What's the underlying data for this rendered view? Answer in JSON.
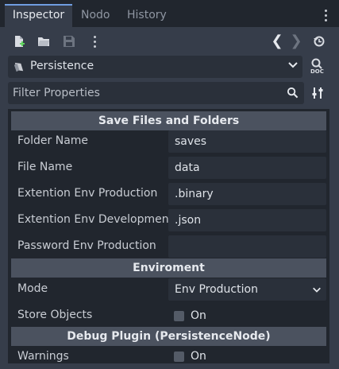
{
  "tabs": [
    {
      "label": "Inspector",
      "active": true
    },
    {
      "label": "Nodo",
      "active": false
    },
    {
      "label": "History",
      "active": false
    }
  ],
  "toolbar": {
    "back": "❮",
    "forward": "❯"
  },
  "resource": {
    "name": "Persistence",
    "doc_label": "DOC"
  },
  "filter": {
    "placeholder": "Filter Properties"
  },
  "sections": {
    "save": "Save Files and Folders",
    "env": "Enviroment",
    "debug": "Debug Plugin (PersistenceNode)"
  },
  "properties": {
    "folder_name": {
      "label": "Folder Name",
      "value": "saves"
    },
    "file_name": {
      "label": "File Name",
      "value": "data"
    },
    "ext_prod": {
      "label": "Extention Env Production",
      "value": ".binary"
    },
    "ext_dev": {
      "label": "Extention Env Development",
      "value": ".json"
    },
    "pass_prod": {
      "label": "Password Env Production",
      "value": ""
    },
    "mode": {
      "label": "Mode",
      "value": "Env Production"
    },
    "store_objects": {
      "label": "Store Objects",
      "value": "On",
      "checked": false
    },
    "warnings": {
      "label": "Warnings",
      "value": "On",
      "checked": false
    }
  },
  "colors": {
    "accent": "#6f9de0",
    "section_bg": "#4b525f",
    "panel_bg": "#21262e"
  }
}
